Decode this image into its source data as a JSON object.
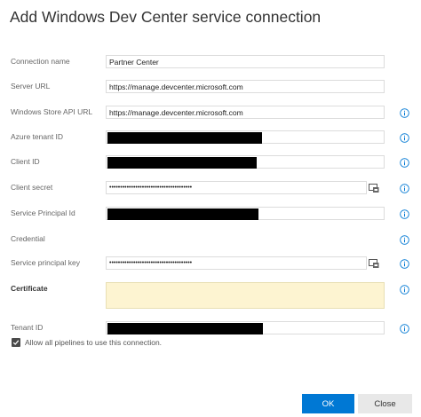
{
  "dialog": {
    "title": "Add Windows Dev Center service connection"
  },
  "fields": {
    "connection_name": {
      "label": "Connection name",
      "value": "Partner Center"
    },
    "server_url": {
      "label": "Server URL",
      "value": "https://manage.devcenter.microsoft.com"
    },
    "store_api_url": {
      "label": "Windows Store API URL",
      "value": "https://manage.devcenter.microsoft.com"
    },
    "azure_tenant_id": {
      "label": "Azure tenant ID",
      "value": ""
    },
    "client_id": {
      "label": "Client ID",
      "value": ""
    },
    "client_secret": {
      "label": "Client secret",
      "value": "••••••••••••••••••••••••••••••••••••••"
    },
    "service_principal_id": {
      "label": "Service Principal Id",
      "value": ""
    },
    "credential": {
      "label": "Credential"
    },
    "service_principal_key": {
      "label": "Service principal key",
      "value": "••••••••••••••••••••••••••••••••••••••"
    },
    "certificate": {
      "label": "Certificate",
      "value": ""
    },
    "tenant_id": {
      "label": "Tenant ID",
      "value": ""
    }
  },
  "allow_pipelines": {
    "label": "Allow all pipelines to use this connection.",
    "checked": true
  },
  "buttons": {
    "ok": "OK",
    "close": "Close"
  },
  "colors": {
    "primary": "#0078d4",
    "info_icon": "#0078d4",
    "certificate_bg": "#fdf4d1",
    "redaction": "#000000"
  },
  "icons": {
    "info": "info-circle-icon",
    "reveal": "reveal-password-icon",
    "check": "checkmark-icon"
  }
}
